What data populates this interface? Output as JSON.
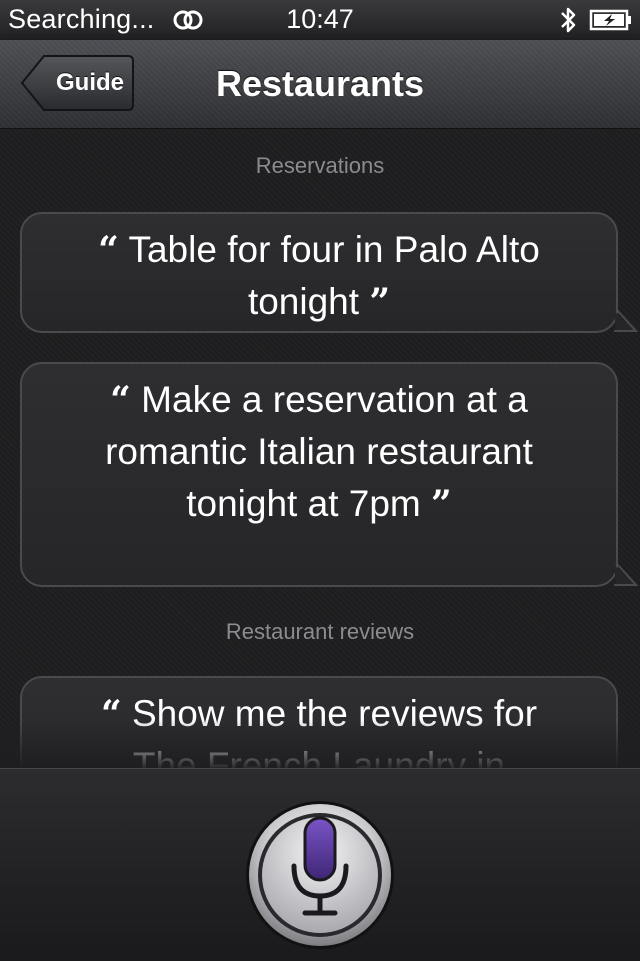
{
  "status": {
    "carrier": "Searching...",
    "time": "10:47"
  },
  "nav": {
    "back_label": "Guide",
    "title": "Restaurants"
  },
  "sections": [
    {
      "header": "Reservations",
      "items": [
        {
          "text": "Table for four in Palo Alto tonight"
        },
        {
          "text": "Make a reservation at a romantic Italian restaurant tonight at 7pm"
        }
      ]
    },
    {
      "header": "Restaurant reviews",
      "items": [
        {
          "text": "Show me the reviews for The French Laundry in"
        }
      ]
    }
  ],
  "icons": {
    "activity": "activity-spinner-icon",
    "bluetooth": "bluetooth-icon",
    "battery": "battery-charging-icon",
    "microphone": "microphone-icon"
  },
  "colors": {
    "mic_accent": "#5a3a9a",
    "section_header": "#8c8c8f"
  }
}
